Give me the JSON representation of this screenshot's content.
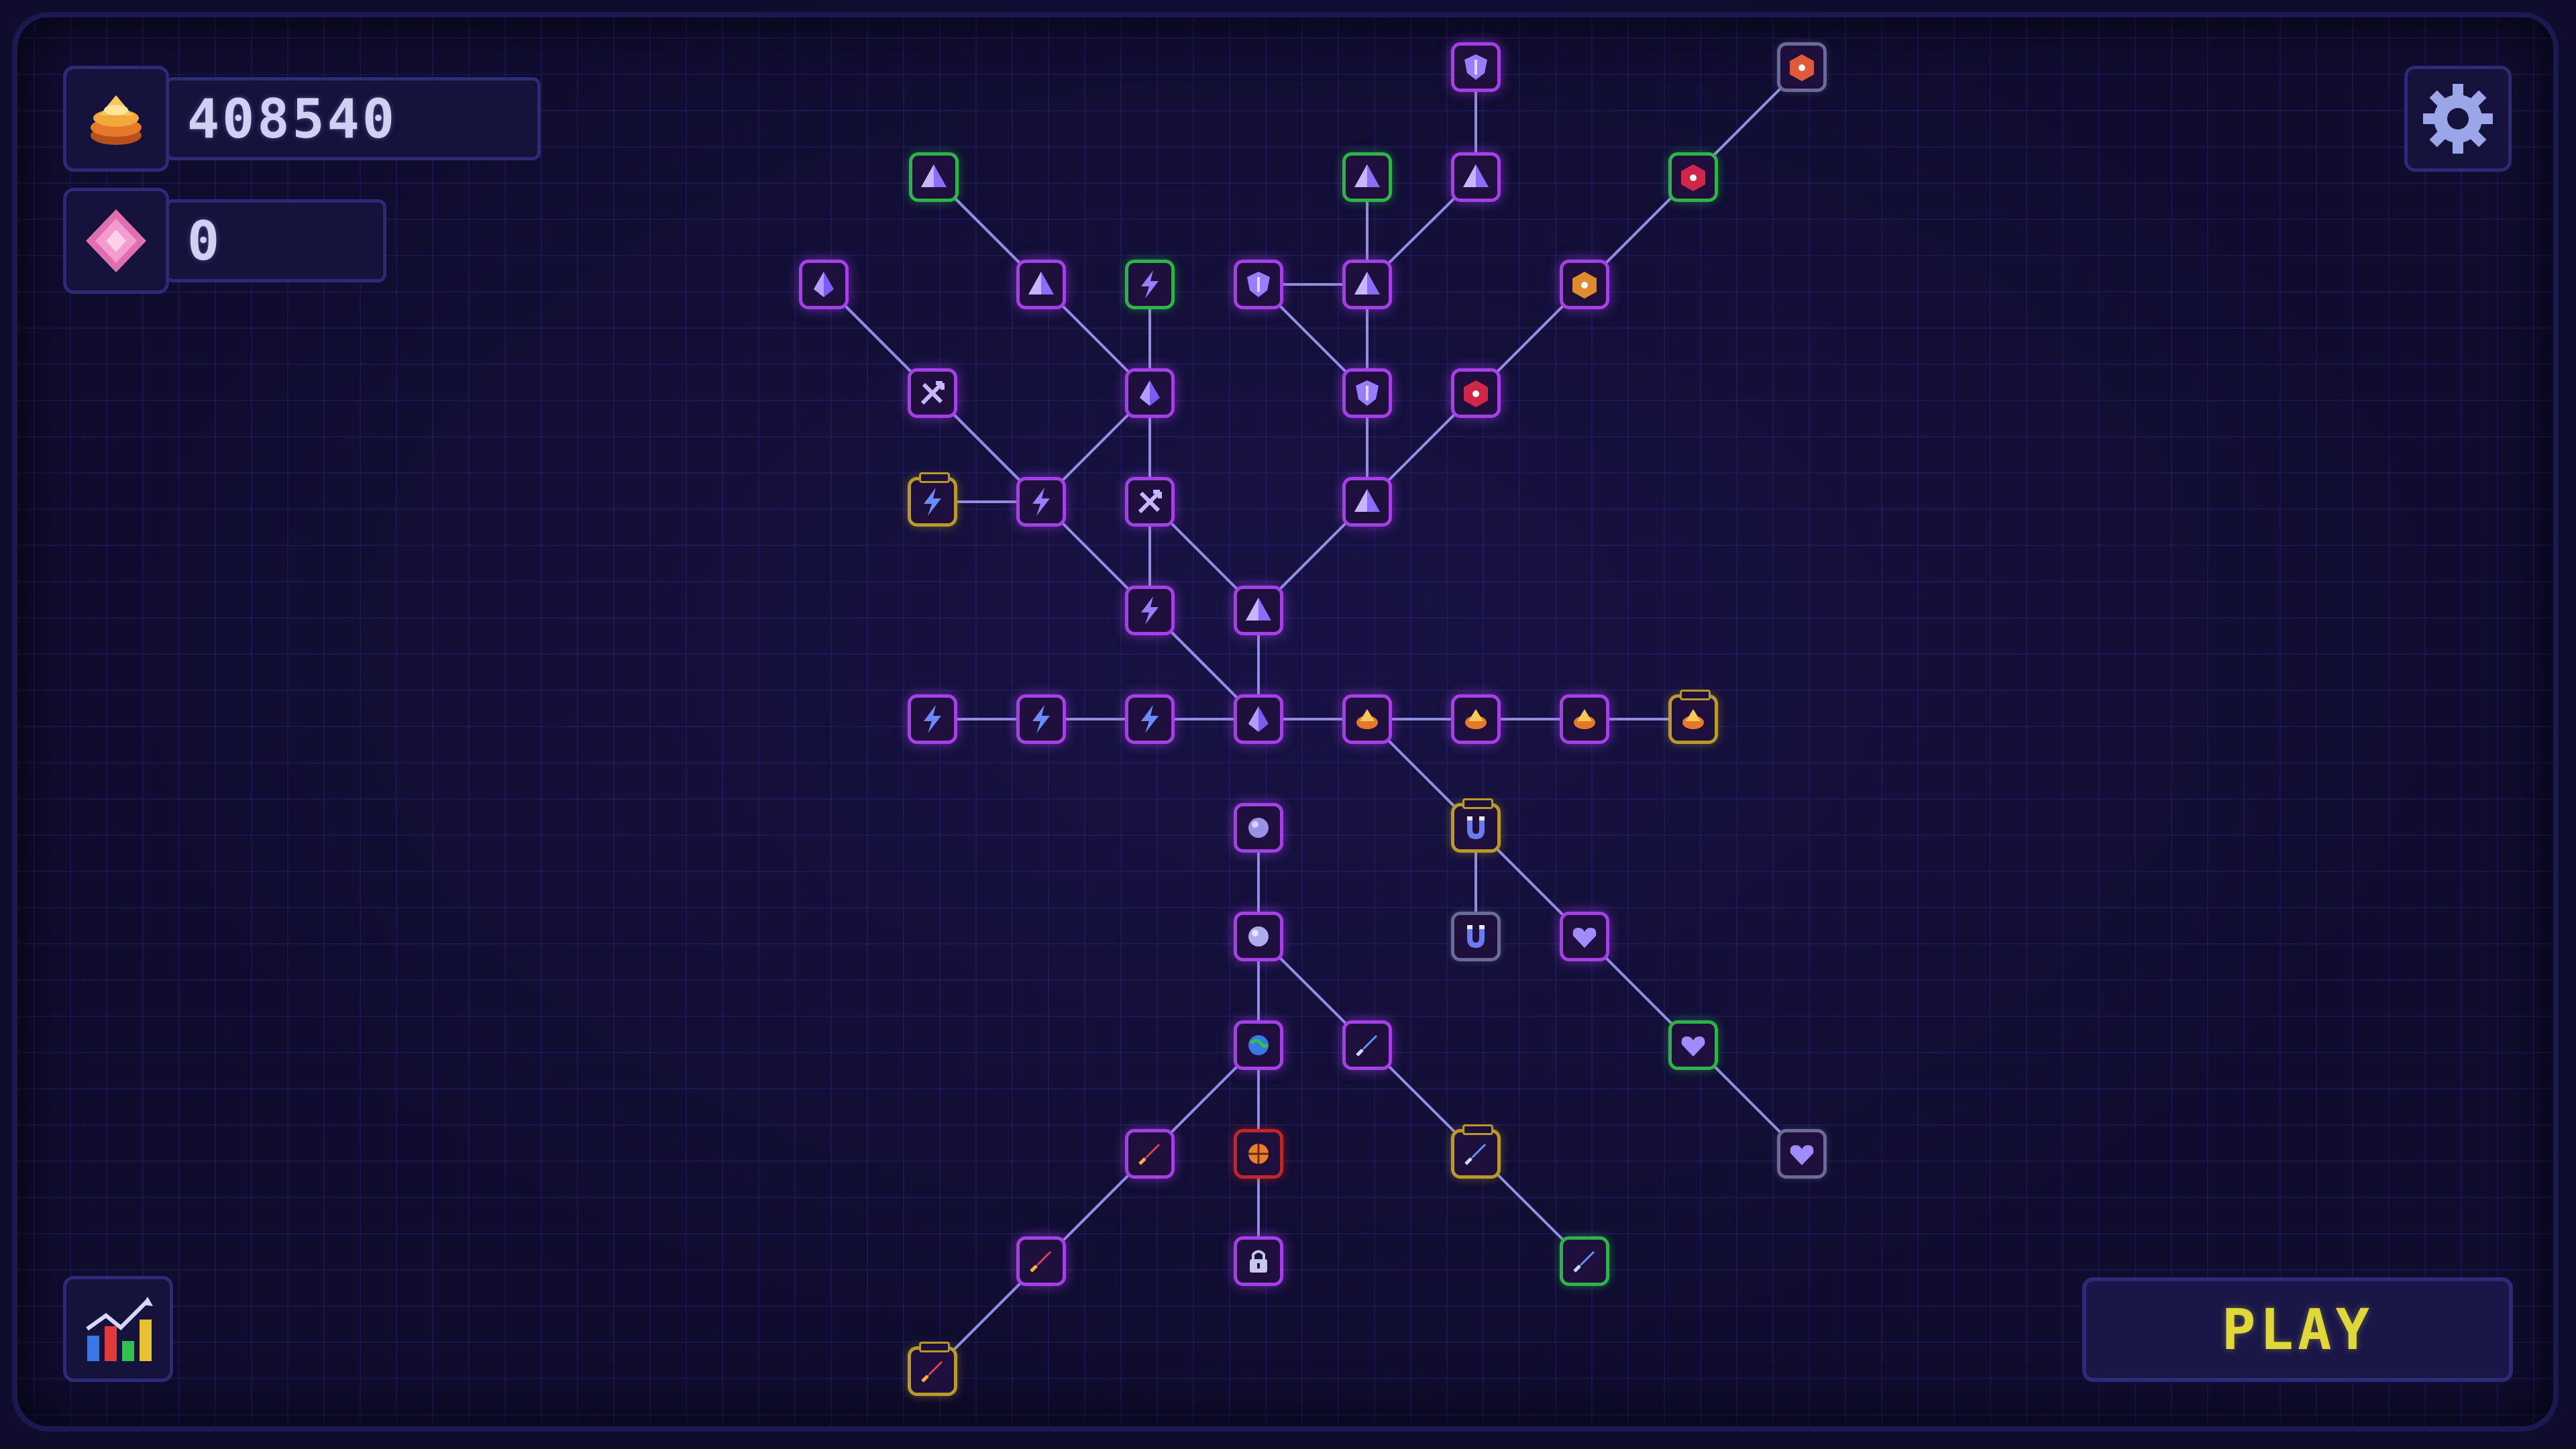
{
  "hud": {
    "coins": {
      "icon": "coin-stack-icon",
      "value": "408540"
    },
    "gems": {
      "icon": "pink-gem-icon",
      "value": "0"
    }
  },
  "buttons": {
    "settings": {
      "icon": "gear-icon"
    },
    "stats": {
      "icon": "bar-chart-icon"
    },
    "play": {
      "label": "PLAY"
    }
  },
  "colors": {
    "node_purchased": "#a53fe6",
    "node_maxed": "#2fb249",
    "node_gold": "#b89a2a",
    "node_locked": "#6c6a98",
    "node_red": "#c2252a",
    "link": "#a8a4ff",
    "play_text": "#e0d83a"
  },
  "skill_tree": {
    "nodes": [
      {
        "id": "root",
        "icon": "diamond-icon",
        "state": "purchased"
      },
      {
        "id": "bolt-1",
        "icon": "lightning-icon",
        "state": "purchased"
      },
      {
        "id": "bolt-2",
        "icon": "lightning-icon",
        "state": "purchased"
      },
      {
        "id": "bolt-3",
        "icon": "lightning-icon",
        "state": "purchased"
      },
      {
        "id": "coin-1",
        "icon": "coin-icon",
        "state": "purchased"
      },
      {
        "id": "coin-2",
        "icon": "coin-icon",
        "state": "purchased"
      },
      {
        "id": "coin-3",
        "icon": "coin-icon",
        "state": "purchased"
      },
      {
        "id": "coin-4",
        "icon": "coin-icon",
        "state": "upgradeable"
      },
      {
        "id": "up-1",
        "icon": "pyramid-icon",
        "state": "purchased"
      },
      {
        "id": "up-bolt-1",
        "icon": "lightning-icon",
        "state": "purchased"
      },
      {
        "id": "up-arrows",
        "icon": "arrows-icon",
        "state": "purchased"
      },
      {
        "id": "up-pyr-2",
        "icon": "pyramid-icon",
        "state": "purchased"
      },
      {
        "id": "up-bolt-2",
        "icon": "lightning-icon",
        "state": "purchased"
      },
      {
        "id": "up-bolt-3",
        "icon": "lightning-icon",
        "state": "upgradeable"
      },
      {
        "id": "up-arrows-2",
        "icon": "arrows-icon",
        "state": "purchased"
      },
      {
        "id": "up-pyr-3",
        "icon": "pyramid-icon",
        "state": "purchased"
      },
      {
        "id": "up-diamond",
        "icon": "diamond-icon",
        "state": "purchased"
      },
      {
        "id": "up-diamond-2",
        "icon": "diamond-icon",
        "state": "purchased"
      },
      {
        "id": "up-pyr-4",
        "icon": "pyramid-icon",
        "state": "purchased"
      },
      {
        "id": "up-pyr-5",
        "icon": "pyramid-icon",
        "state": "maxed"
      },
      {
        "id": "up-bolt-4",
        "icon": "lightning-icon",
        "state": "maxed"
      },
      {
        "id": "up-shield",
        "icon": "shield-icon",
        "state": "purchased"
      },
      {
        "id": "up-pyr-6",
        "icon": "pyramid-icon",
        "state": "purchased"
      },
      {
        "id": "up-shield-2",
        "icon": "shield-icon",
        "state": "purchased"
      },
      {
        "id": "up-pyr-7",
        "icon": "pyramid-icon",
        "state": "maxed"
      },
      {
        "id": "up-pyr-8",
        "icon": "pyramid-icon",
        "state": "purchased"
      },
      {
        "id": "up-shield-3",
        "icon": "shield-icon",
        "state": "purchased"
      },
      {
        "id": "up-dice",
        "icon": "dice-icon",
        "state": "purchased"
      },
      {
        "id": "up-dice-2",
        "icon": "dice-icon",
        "state": "purchased"
      },
      {
        "id": "up-dice-3",
        "icon": "dice-icon",
        "state": "maxed"
      },
      {
        "id": "up-dice-4",
        "icon": "dice-icon",
        "state": "locked"
      },
      {
        "id": "down-orb",
        "icon": "orb-icon",
        "state": "purchased"
      },
      {
        "id": "down-orb-2",
        "icon": "orb-icon",
        "state": "purchased"
      },
      {
        "id": "down-globe",
        "icon": "globe-icon",
        "state": "purchased"
      },
      {
        "id": "down-rocket",
        "icon": "rocket-icon",
        "state": "purchased"
      },
      {
        "id": "down-rocket-2",
        "icon": "rocket-icon",
        "state": "purchased"
      },
      {
        "id": "down-rocket-3",
        "icon": "rocket-icon",
        "state": "upgradeable"
      },
      {
        "id": "down-basket",
        "icon": "basketball-icon",
        "state": "red"
      },
      {
        "id": "down-lock",
        "icon": "lock-icon",
        "state": "purchased"
      },
      {
        "id": "down-feather",
        "icon": "feather-icon",
        "state": "purchased"
      },
      {
        "id": "down-feather-2",
        "icon": "feather-icon",
        "state": "upgradeable"
      },
      {
        "id": "down-feather-3",
        "icon": "feather-icon",
        "state": "maxed"
      },
      {
        "id": "magnet",
        "icon": "magnet-icon",
        "state": "upgradeable"
      },
      {
        "id": "magnet-2",
        "icon": "magnet-icon",
        "state": "locked"
      },
      {
        "id": "heart-1",
        "icon": "heart-icon",
        "state": "purchased"
      },
      {
        "id": "heart-2",
        "icon": "heart-icon",
        "state": "maxed"
      },
      {
        "id": "heart-3",
        "icon": "heart-icon",
        "state": "locked"
      }
    ]
  }
}
